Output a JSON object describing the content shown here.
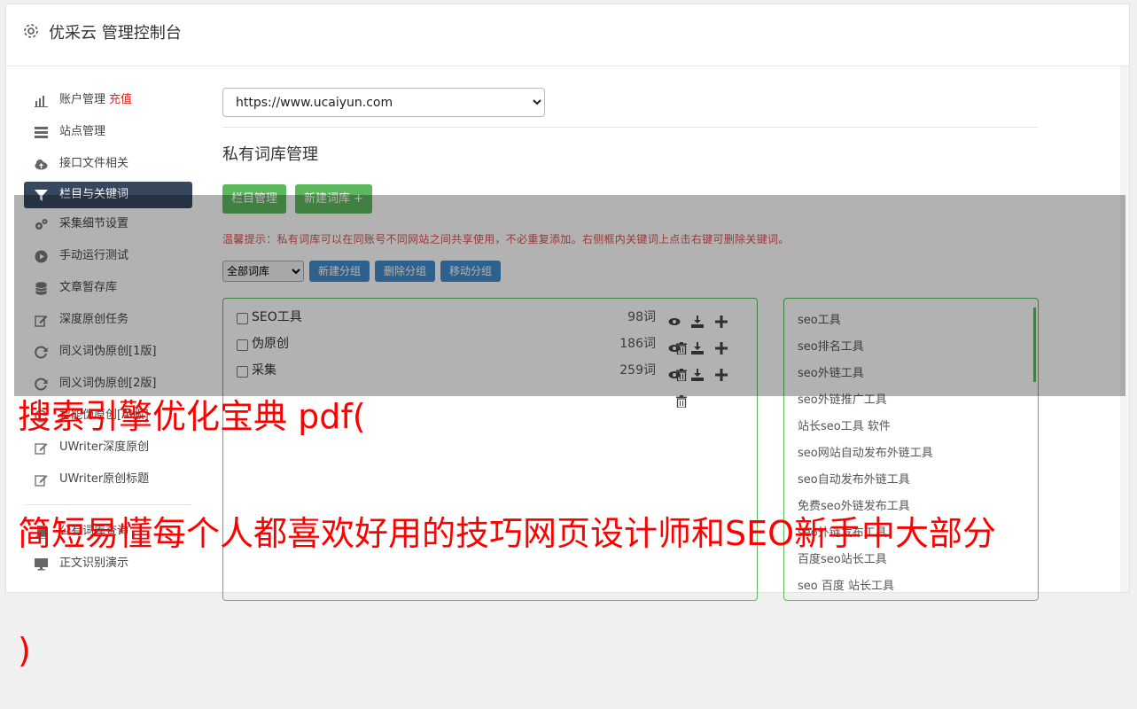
{
  "header": {
    "title": "优采云 管理控制台"
  },
  "sidebar": {
    "items": [
      {
        "label": "账户管理",
        "badge": "充值",
        "icon": "bar-chart-icon"
      },
      {
        "label": "站点管理",
        "icon": "server-icon"
      },
      {
        "label": "接口文件相关",
        "icon": "cloud-upload-icon"
      },
      {
        "label": "栏目与关键词",
        "icon": "filter-icon",
        "active": true
      },
      {
        "label": "采集细节设置",
        "icon": "gears-icon"
      },
      {
        "label": "手动运行测试",
        "icon": "play-circle-icon"
      },
      {
        "label": "文章暂存库",
        "icon": "database-icon"
      },
      {
        "label": "深度原创任务",
        "icon": "edit-icon"
      },
      {
        "label": "同义词伪原创[1版]",
        "icon": "refresh-icon"
      },
      {
        "label": "同义词伪原创[2版]",
        "icon": "refresh-icon"
      },
      {
        "label": "智能伪原创[AI版]",
        "icon": "refresh-icon"
      },
      {
        "label": "UWriter深度原创",
        "icon": "edit-icon"
      },
      {
        "label": "UWriter原创标题",
        "icon": "edit-icon"
      }
    ],
    "items2": [
      {
        "label": "公有词库查询",
        "icon": "book-icon"
      },
      {
        "label": "正文识别演示",
        "icon": "monitor-icon"
      }
    ]
  },
  "main": {
    "site_select": "https://www.ucaiyun.com",
    "page_title": "私有词库管理",
    "buttons": {
      "column_manage": "栏目管理",
      "new_library": "新建词库 +"
    },
    "tip": "温馨提示：私有词库可以在同账号不同网站之间共享使用，不必重复添加。右侧框内关键词上点击右键可删除关键词。",
    "group_select": "全部词库",
    "group_buttons": {
      "new_group": "新建分组",
      "delete_group": "删除分组",
      "move_group": "移动分组"
    },
    "libraries": [
      {
        "name": "SEO工具",
        "count": "98词"
      },
      {
        "name": "伪原创",
        "count": "186词"
      },
      {
        "name": "采集",
        "count": "259词"
      }
    ],
    "keywords": [
      "seo工具",
      "seo排名工具",
      "seo外链工具",
      "seo外链推广工具",
      "站长seo工具 软件",
      "seo网站自动发布外链工具",
      "seo自动发布外链工具",
      "免费seo外链发布工具",
      "seo外链发布工具",
      "百度seo站长工具",
      "seo 百度 站长工具"
    ]
  },
  "banner": {
    "line1": "搜索引擎优化宝典 pdf(",
    "line2": "简短易懂每个人都喜欢好用的技巧网页设计师和SEO新手中大部分",
    "line3": ")"
  },
  "colors": {
    "active_bg": "#37475f",
    "green": "#5cb85c",
    "blue": "#428bca",
    "red_banner": "#ff0000",
    "tip_red": "#d9534f"
  }
}
